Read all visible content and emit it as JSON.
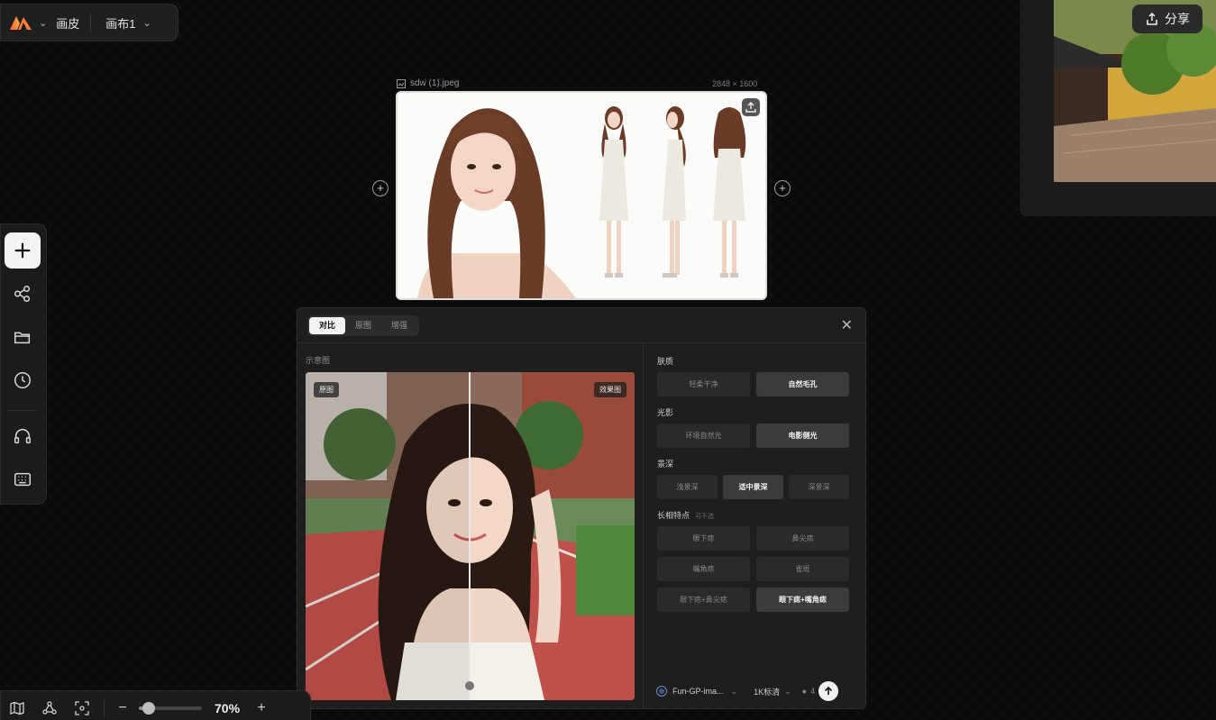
{
  "topbar": {
    "app_menu": "画皮",
    "canvas_name": "画布1"
  },
  "image_node": {
    "filename": "sdw (1).jpeg",
    "dimensions": "2848 × 1600"
  },
  "share": {
    "label": "分享"
  },
  "panel": {
    "tabs": [
      "对比",
      "原图",
      "增强"
    ],
    "preview_label": "示意图",
    "tag_original": "原图",
    "tag_result": "效果图",
    "groups": {
      "skin": {
        "label": "肤质",
        "options": [
          "轻柔干净",
          "自然毛孔"
        ]
      },
      "light": {
        "label": "光影",
        "options": [
          "环境自然光",
          "电影侧光"
        ]
      },
      "depth": {
        "label": "景深",
        "options": [
          "浅景深",
          "适中景深",
          "深景深"
        ]
      },
      "features": {
        "label": "长相特点",
        "hint": "可不选",
        "options": [
          "眼下痣",
          "鼻尖痣",
          "嘴角痣",
          "雀斑",
          "眼下痣+鼻尖痣",
          "眼下痣+嘴角痣"
        ]
      }
    },
    "footer": {
      "model": "Fun-GP-ima...",
      "resolution": "1K标清",
      "credits": "4"
    }
  },
  "bottombar": {
    "zoom": "70%",
    "zoom_level": 0.7
  }
}
